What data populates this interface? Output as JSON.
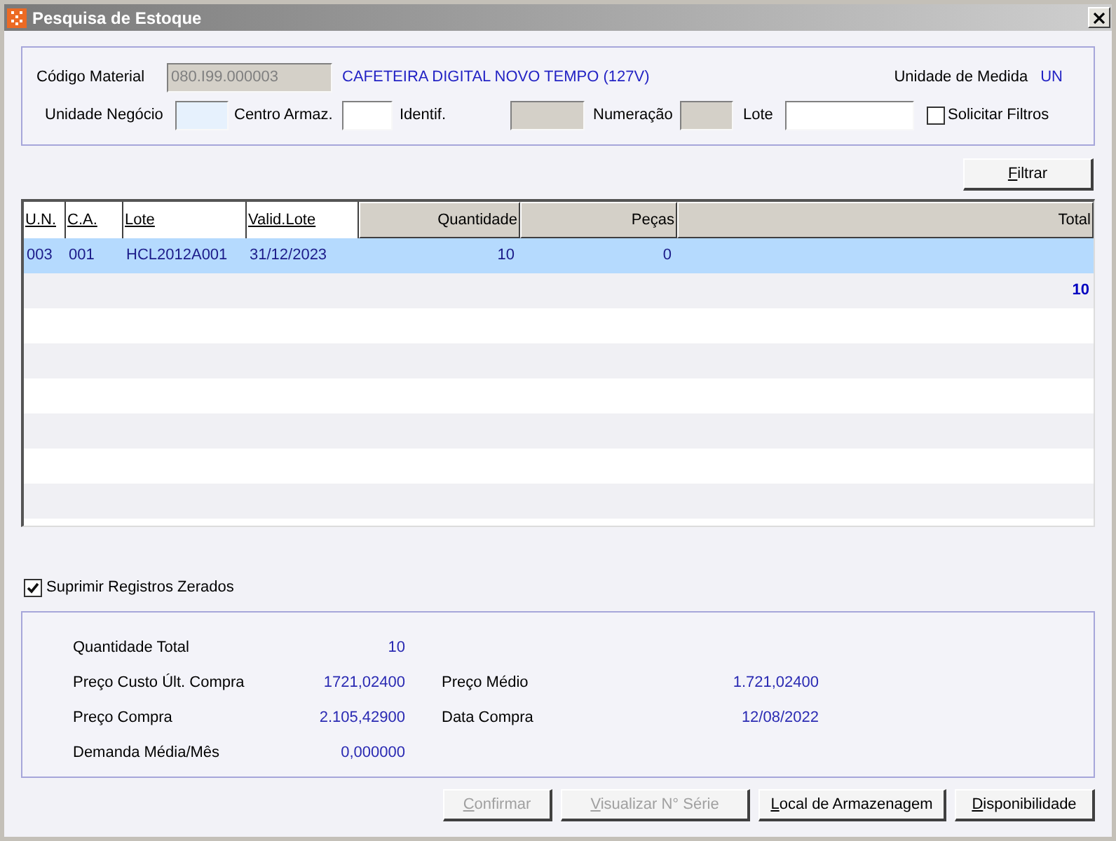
{
  "window": {
    "title": "Pesquisa de Estoque"
  },
  "material": {
    "label": "Código Material",
    "value": "080.I99.000003",
    "disabled": true,
    "description": "CAFETEIRA DIGITAL NOVO TEMPO (127V)",
    "unit_label": "Unidade de Medida",
    "unit": "UN"
  },
  "filters": [
    {
      "label": "Unidade Negócio",
      "disabled": false,
      "focused": true
    },
    {
      "label": "Centro Armaz.",
      "disabled": false,
      "focused": false
    },
    {
      "label": "Identif.",
      "disabled": true,
      "focused": false
    },
    {
      "label": "Numeração",
      "disabled": true,
      "focused": false
    },
    {
      "label": "Lote",
      "disabled": false,
      "focused": false
    }
  ],
  "request_filters": {
    "label": "Solicitar Filtros",
    "checked": false
  },
  "filter_button": {
    "label": "Filtrar"
  },
  "table": {
    "columns": [
      {
        "label": "U.N.",
        "kind": "key"
      },
      {
        "label": "C.A.",
        "kind": "key"
      },
      {
        "label": "Lote",
        "kind": "key"
      },
      {
        "label": "Valid.Lote",
        "kind": "key"
      },
      {
        "label": "Quantidade",
        "kind": "numeric"
      },
      {
        "label": "Peças",
        "kind": "numeric"
      },
      {
        "label": "Total",
        "kind": "numeric"
      }
    ],
    "rows": [
      {
        "selected": true,
        "cells": [
          "003",
          "001",
          "HCL2012A001",
          "31/12/2023",
          "10",
          "0"
        ]
      }
    ],
    "total_row": {
      "value": "10"
    }
  },
  "suppress_zero": {
    "label": "Suprimir Registros Zerados",
    "checked": true
  },
  "summary": [
    {
      "fields": [
        {
          "label": "Quantidade Total",
          "value": "10"
        }
      ]
    },
    {
      "fields": [
        {
          "label": "Preço Custo Últ. Compra",
          "value": "1721,02400"
        },
        {
          "label": "Preço Médio",
          "value": "1.721,02400"
        }
      ]
    },
    {
      "fields": [
        {
          "label": "Preço Compra",
          "value": "2.105,42900"
        },
        {
          "label": "Data Compra",
          "value": "12/08/2022"
        }
      ]
    },
    {
      "fields": [
        {
          "label": "Demanda Média/Mês",
          "value": "0,000000"
        }
      ]
    }
  ],
  "buttons": [
    {
      "label": "Confirmar",
      "disabled": true
    },
    {
      "label": "Visualizar N° Série",
      "disabled": true
    },
    {
      "label": "Local de Armazenagem",
      "disabled": false
    },
    {
      "label": "Disponibilidade",
      "disabled": false
    }
  ]
}
